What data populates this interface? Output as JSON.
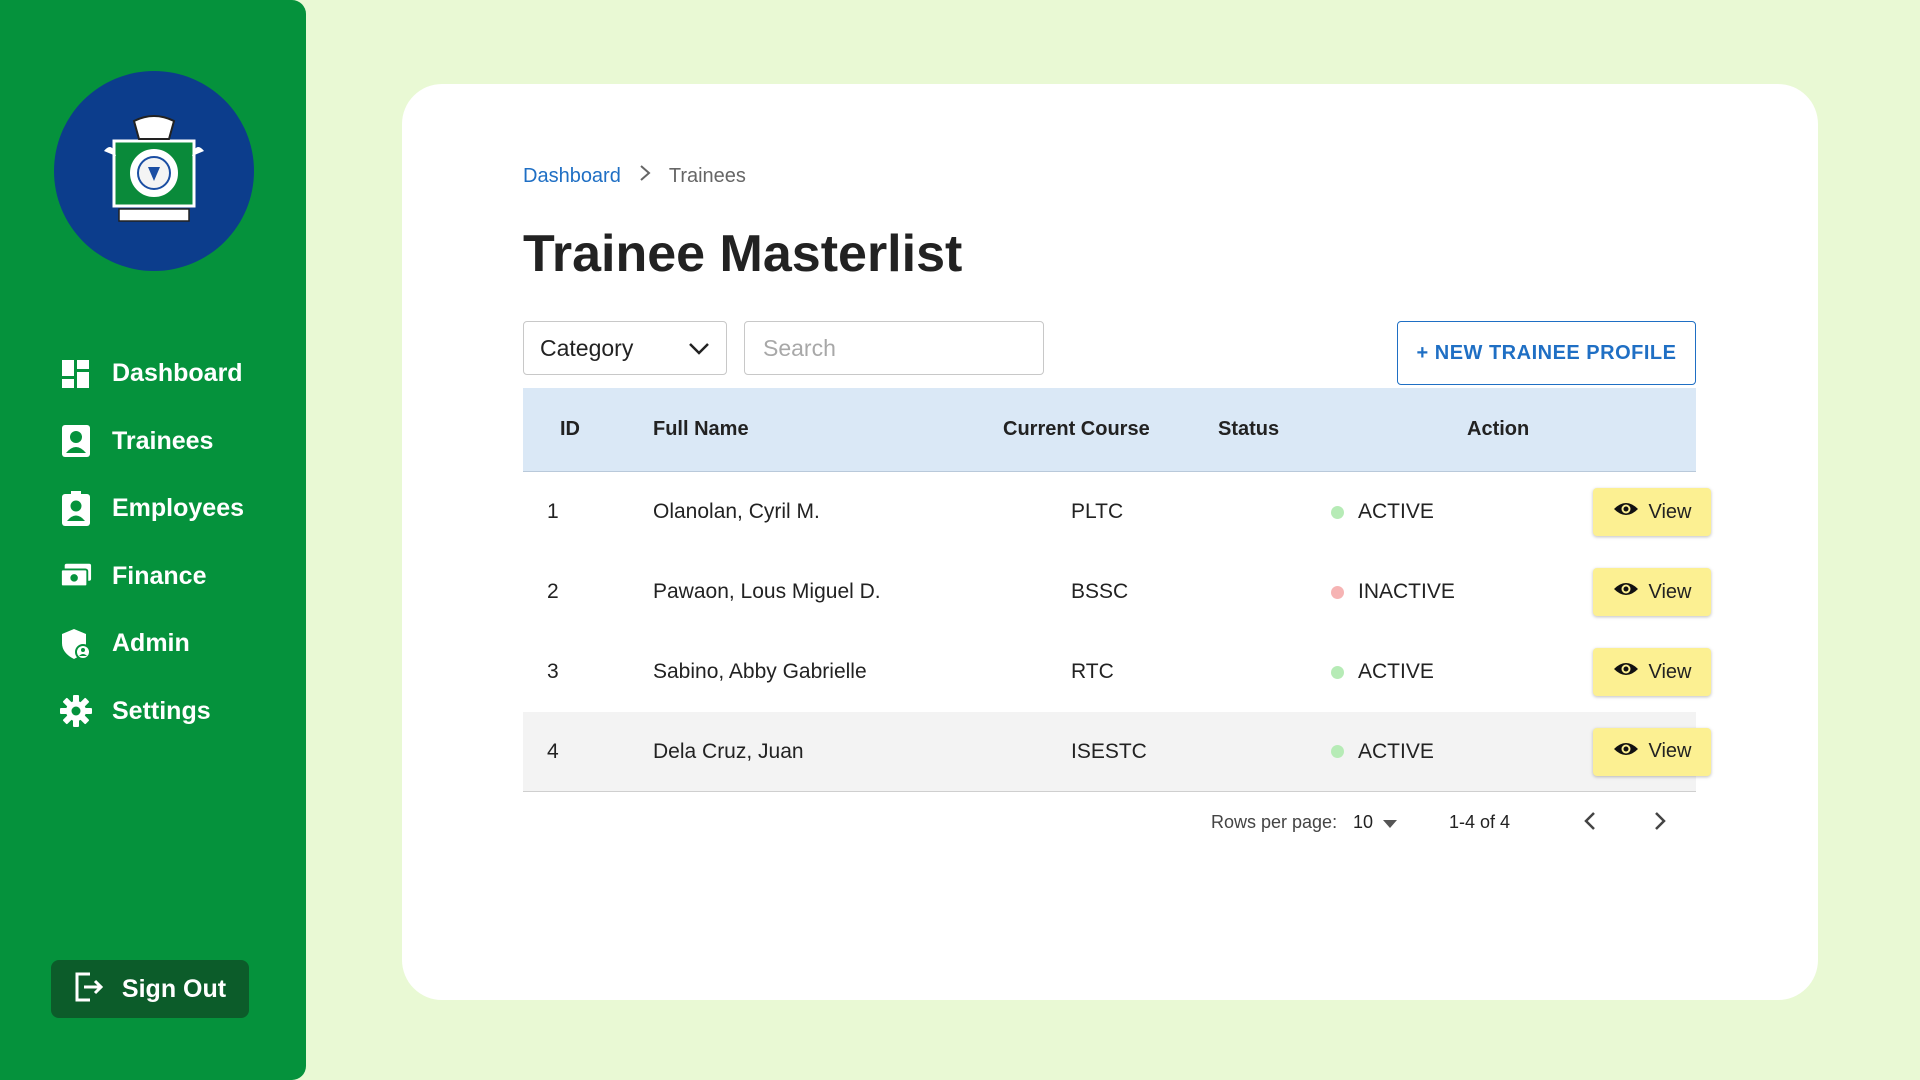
{
  "sidebar": {
    "logo_name": "institution-seal-logo",
    "items": [
      {
        "label": "Dashboard",
        "icon": "dashboard-icon"
      },
      {
        "label": "Trainees",
        "icon": "person-card-icon"
      },
      {
        "label": "Employees",
        "icon": "employee-badge-icon"
      },
      {
        "label": "Finance",
        "icon": "cash-icon"
      },
      {
        "label": "Admin",
        "icon": "admin-shield-icon"
      },
      {
        "label": "Settings",
        "icon": "gear-icon"
      }
    ],
    "sign_out_label": "Sign Out"
  },
  "breadcrumb": {
    "parent": "Dashboard",
    "current": "Trainees"
  },
  "page_title": "Trainee Masterlist",
  "filters": {
    "category_label": "Category",
    "search_placeholder": "Search"
  },
  "new_button_label": "+ NEW TRAINEE PROFILE",
  "table": {
    "headers": {
      "id": "ID",
      "name": "Full Name",
      "course": "Current Course",
      "status": "Status",
      "action": "Action"
    },
    "rows": [
      {
        "id": "1",
        "name": "Olanolan, Cyril M.",
        "course": "PLTC",
        "status": "ACTIVE",
        "action": "View"
      },
      {
        "id": "2",
        "name": "Pawaon, Lous Miguel D.",
        "course": "BSSC",
        "status": "INACTIVE",
        "action": "View"
      },
      {
        "id": "3",
        "name": "Sabino, Abby Gabrielle",
        "course": "RTC",
        "status": "ACTIVE",
        "action": "View"
      },
      {
        "id": "4",
        "name": "Dela Cruz, Juan",
        "course": "ISESTC",
        "status": "ACTIVE",
        "action": "View"
      }
    ]
  },
  "pagination": {
    "rows_per_page_label": "Rows per page:",
    "rows_per_page_value": "10",
    "range": "1-4 of 4"
  },
  "colors": {
    "sidebar": "#05923c",
    "page_bg": "#e9f9d4",
    "active_dot": "#b6ebb6",
    "inactive_dot": "#f6b4b4",
    "view_button": "#fcf092",
    "accent_blue": "#1f6fc4"
  }
}
